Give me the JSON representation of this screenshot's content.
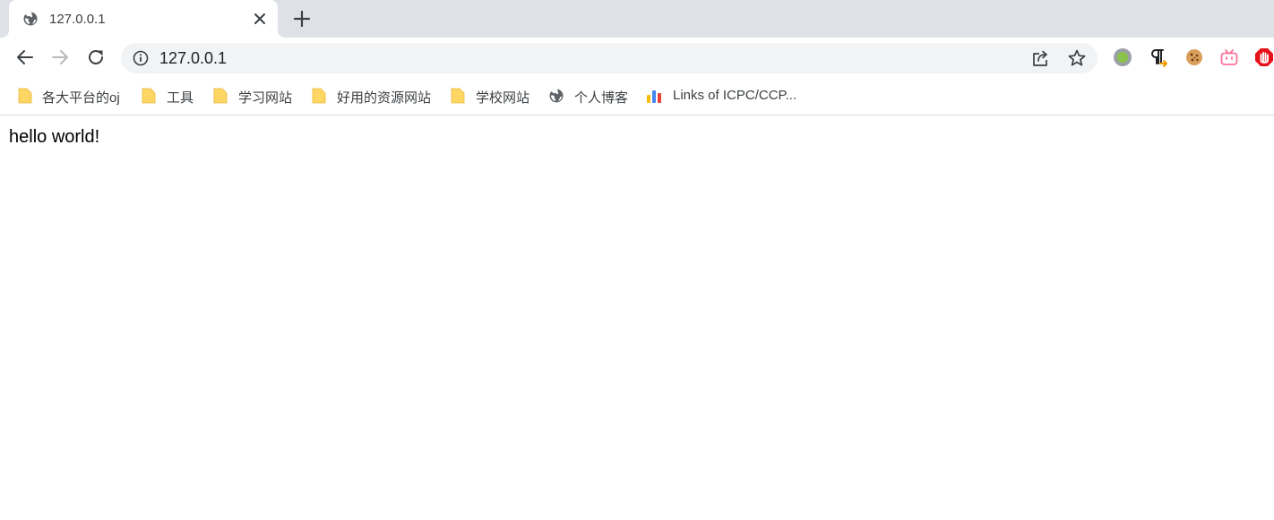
{
  "tab": {
    "title": "127.0.0.1",
    "favicon_icon": "globe-icon",
    "close_icon": "close-icon"
  },
  "new_tab_icon": "plus-icon",
  "toolbar": {
    "back_icon": "back-arrow-icon",
    "forward_icon": "forward-arrow-icon",
    "reload_icon": "reload-icon",
    "address": {
      "info_icon": "info-icon",
      "url": "127.0.0.1",
      "share_icon": "share-icon",
      "bookmark_icon": "star-icon"
    },
    "extensions": [
      {
        "name": "grey-circle-extension-icon"
      },
      {
        "name": "paragraph-extension-icon"
      },
      {
        "name": "cookie-extension-icon"
      },
      {
        "name": "bilibili-extension-icon"
      },
      {
        "name": "adblock-hand-extension-icon"
      }
    ]
  },
  "bookmarks": [
    {
      "label": "各大平台的oj",
      "icon": "folder-icon"
    },
    {
      "label": "工具",
      "icon": "folder-icon"
    },
    {
      "label": "学习网站",
      "icon": "folder-icon"
    },
    {
      "label": "好用的资源网站",
      "icon": "folder-icon"
    },
    {
      "label": "学校网站",
      "icon": "folder-icon"
    },
    {
      "label": "个人博客",
      "icon": "globe-icon"
    },
    {
      "label": "Links of ICPC/CCP...",
      "icon": "bar-chart-icon"
    }
  ],
  "page": {
    "body_text": "hello world!"
  },
  "colors": {
    "tabstrip_bg": "#dee1e6",
    "omnibox_bg": "#f1f3f4",
    "folder_yellow": "#fdd663",
    "adblock_red": "#e8111a",
    "bilibili_pink": "#fb7299"
  }
}
